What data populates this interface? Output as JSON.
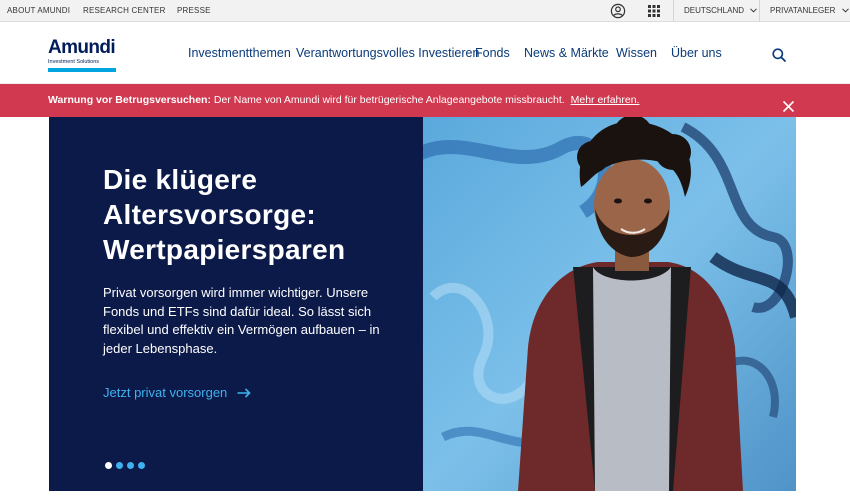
{
  "utility": {
    "about": "ABOUT AMUNDI",
    "research": "RESEARCH CENTER",
    "press": "PRESSE",
    "region": "DEUTSCHLAND",
    "audience": "PRIVATANLEGER"
  },
  "logo": {
    "brand": "Amundi",
    "tagline": "Investment Solutions"
  },
  "nav": {
    "items": [
      "Investmentthemen",
      "Verantwortungsvolles Investieren",
      "Fonds",
      "News & Märkte",
      "Wissen",
      "Über uns"
    ]
  },
  "alert": {
    "label": "Warnung vor Betrugsversuchen:",
    "text": " Der Name von Amundi wird für betrügerische Anlageangebote missbraucht.",
    "link": "Mehr erfahren."
  },
  "hero": {
    "title_lines": [
      "Die klügere",
      "Altersvorsorge:",
      "Wertpapiersparen"
    ],
    "text": "Privat vorsorgen wird immer wichtiger. Unsere Fonds und ETFs sind dafür ideal. So lässt sich flexibel und effektiv ein Vermögen aufbauen – in jeder Lebensphase.",
    "cta": "Jetzt privat vorsorgen",
    "slides": 4,
    "active_slide": 1
  },
  "colors": {
    "navy": "#0c1a4a",
    "accent": "#3fb1ee",
    "alert": "#d0394f",
    "nav_text": "#0a3a7a"
  }
}
